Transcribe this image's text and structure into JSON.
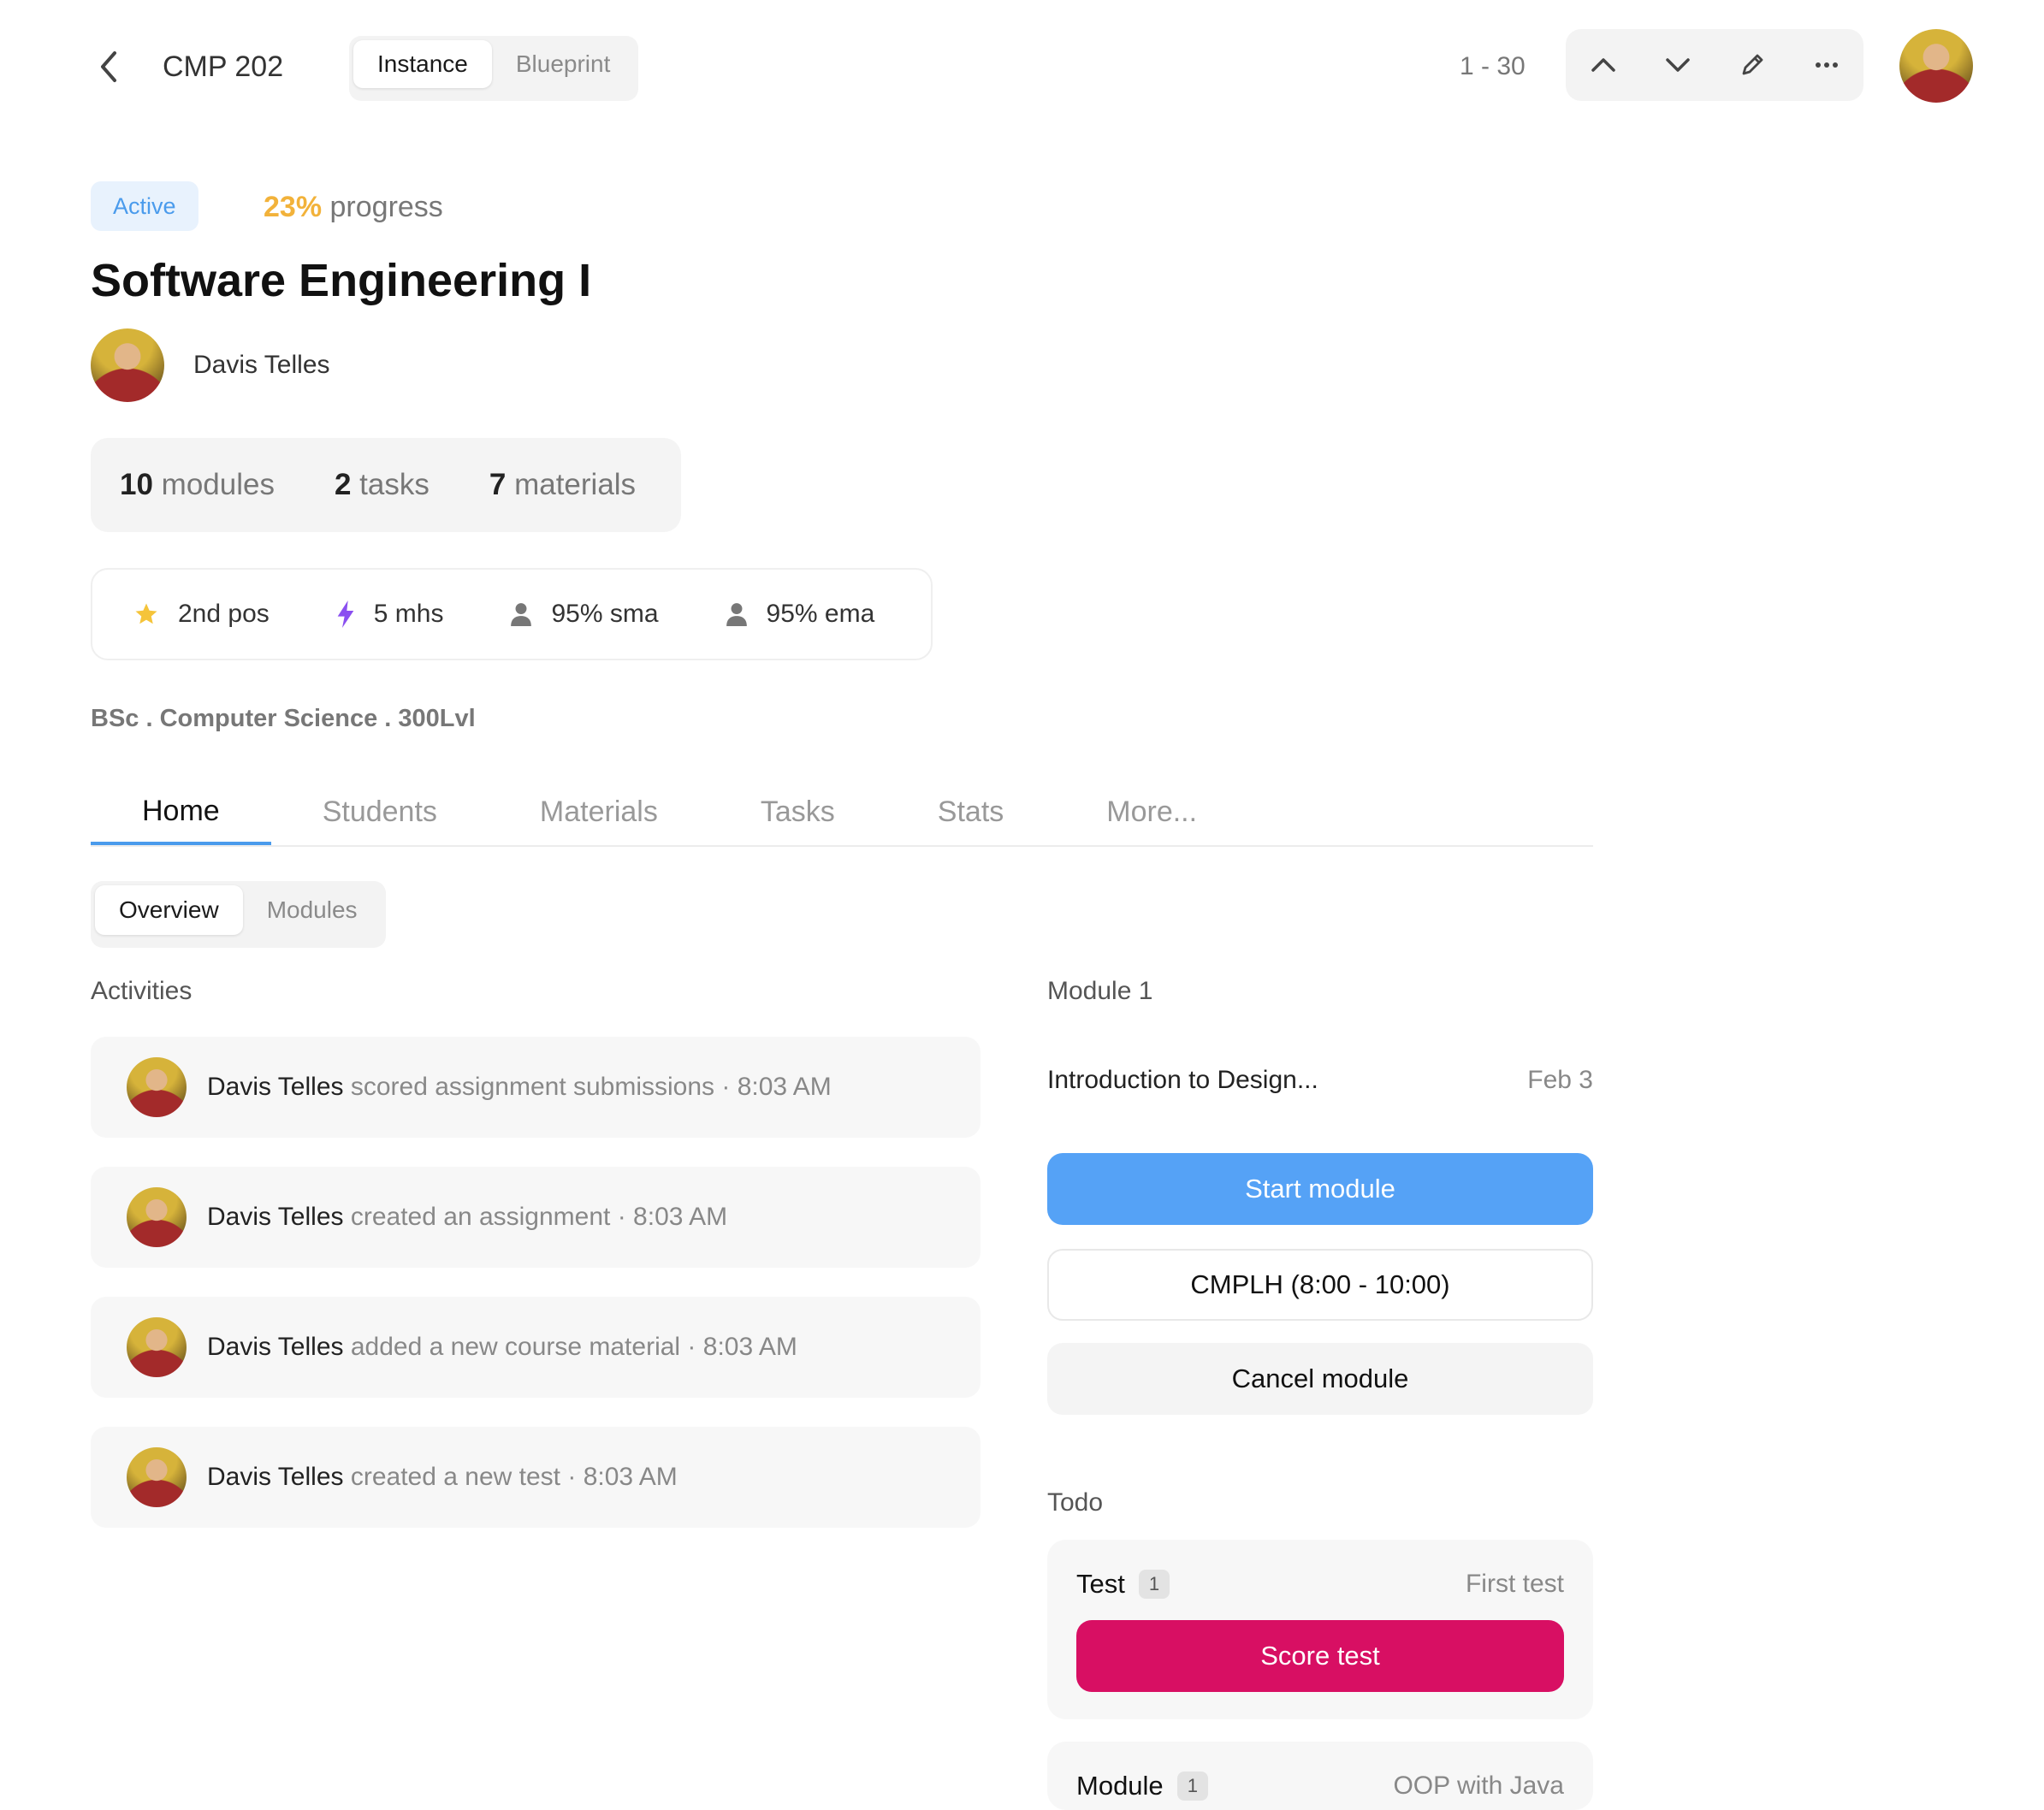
{
  "header": {
    "course_code": "CMP 202",
    "view_toggle": [
      {
        "label": "Instance",
        "active": true
      },
      {
        "label": "Blueprint",
        "active": false
      }
    ],
    "pager": "1 - 30",
    "toolbar_icons": [
      "chevron-up-icon",
      "chevron-down-icon",
      "pencil-icon",
      "more-icon"
    ]
  },
  "course": {
    "status": "Active",
    "progress_pct": "23%",
    "progress_label": "progress",
    "title": "Software Engineering I",
    "owner": "Davis Telles",
    "counts": [
      {
        "num": "10",
        "label": "modules"
      },
      {
        "num": "2",
        "label": "tasks"
      },
      {
        "num": "7",
        "label": "materials"
      }
    ],
    "stats": [
      {
        "icon": "star-icon",
        "label": "2nd pos",
        "color": "#f5c43a"
      },
      {
        "icon": "lightning-icon",
        "label": "5 mhs",
        "color": "#8a4ff0"
      },
      {
        "icon": "person-icon",
        "label": "95% sma",
        "color": "#777777"
      },
      {
        "icon": "person-icon",
        "label": "95% ema",
        "color": "#777777"
      }
    ],
    "program": "BSc . Computer Science . 300Lvl"
  },
  "tabs": [
    "Home",
    "Students",
    "Materials",
    "Tasks",
    "Stats",
    "More..."
  ],
  "active_tab": "Home",
  "subtabs": [
    {
      "label": "Overview",
      "active": true
    },
    {
      "label": "Modules",
      "active": false
    }
  ],
  "activities": {
    "label": "Activities",
    "items": [
      {
        "who": "Davis Telles",
        "action": "scored assignment submissions",
        "time": "8:03 AM"
      },
      {
        "who": "Davis Telles",
        "action": "created an assignment",
        "time": "8:03 AM"
      },
      {
        "who": "Davis Telles",
        "action": "added a new course material",
        "time": "8:03 AM"
      },
      {
        "who": "Davis Telles",
        "action": "created a new test",
        "time": "8:03 AM"
      }
    ]
  },
  "module": {
    "label": "Module 1",
    "name": "Introduction to Design...",
    "date": "Feb 3",
    "start_label": "Start module",
    "slot_label": "CMPLH (8:00 - 10:00)",
    "cancel_label": "Cancel module"
  },
  "todo": {
    "label": "Todo",
    "items": [
      {
        "type": "Test",
        "count": "1",
        "name": "First test",
        "action": "Score test"
      },
      {
        "type": "Module",
        "count": "1",
        "name": "OOP with Java"
      }
    ]
  },
  "colors": {
    "accent": "#4a9bec",
    "primary_button": "#55a2f6",
    "score_button": "#d80f63",
    "progress": "#f2b23a"
  }
}
